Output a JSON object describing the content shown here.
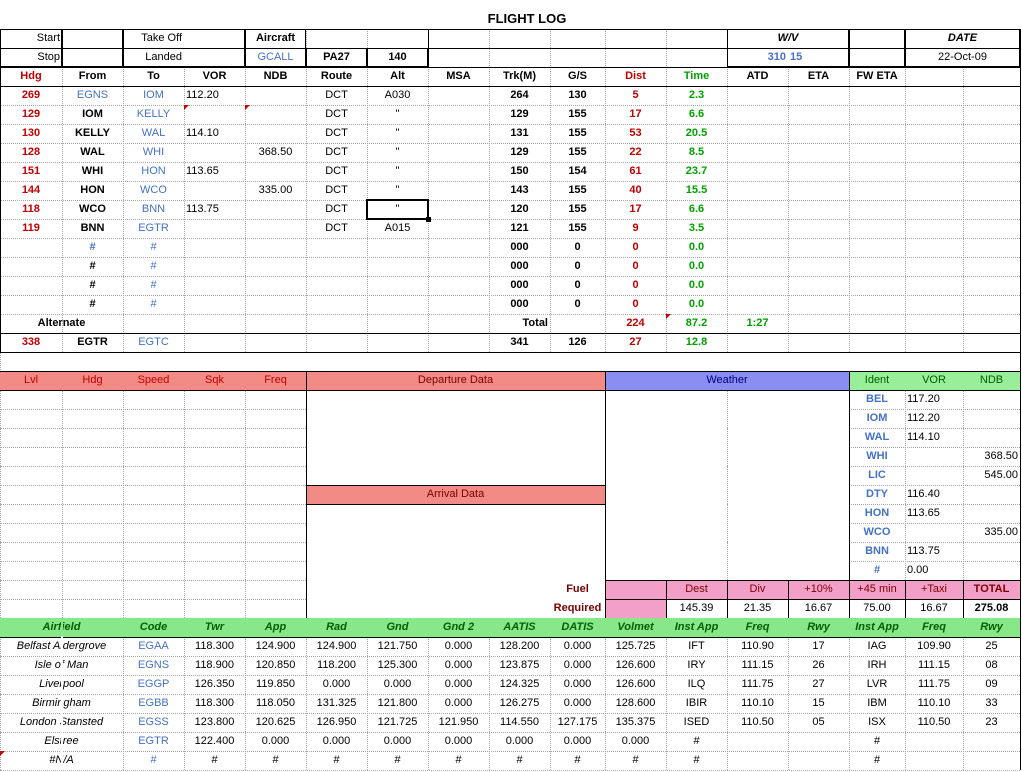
{
  "title": "FLIGHT LOG",
  "header": {
    "start": "Start",
    "stop": "Stop",
    "take_off": "Take Off",
    "landed": "Landed",
    "aircraft_label": "Aircraft",
    "aircraft_reg": "GCALL",
    "aircraft_type": "PA27",
    "aircraft_speed": "140",
    "wv_label": "W/V",
    "wv_dir": "310",
    "wv_speed": "15",
    "date_label": "DATE",
    "date_value": "22-Oct-09"
  },
  "nav": {
    "headers": [
      "Hdg",
      "From",
      "To",
      "VOR",
      "NDB",
      "Route",
      "Alt",
      "MSA",
      "Trk(M)",
      "G/S",
      "Dist",
      "Time",
      "ATD",
      "ETA",
      "FW ETA"
    ],
    "rows": [
      [
        "269",
        "EGNS",
        "IOM",
        "112.20",
        "",
        "DCT",
        "A030",
        "",
        "264",
        "130",
        "5",
        "2.3"
      ],
      [
        "129",
        "IOM",
        "KELLY",
        "",
        "",
        "DCT",
        "\"",
        "",
        "129",
        "155",
        "17",
        "6.6"
      ],
      [
        "130",
        "KELLY",
        "WAL",
        "114.10",
        "",
        "DCT",
        "\"",
        "",
        "131",
        "155",
        "53",
        "20.5"
      ],
      [
        "128",
        "WAL",
        "WHI",
        "",
        "368.50",
        "DCT",
        "\"",
        "",
        "129",
        "155",
        "22",
        "8.5"
      ],
      [
        "151",
        "WHI",
        "HON",
        "113.65",
        "",
        "DCT",
        "\"",
        "",
        "150",
        "154",
        "61",
        "23.7"
      ],
      [
        "144",
        "HON",
        "WCO",
        "",
        "335.00",
        "DCT",
        "\"",
        "",
        "143",
        "155",
        "40",
        "15.5"
      ],
      [
        "118",
        "WCO",
        "BNN",
        "113.75",
        "",
        "DCT",
        "\"",
        "",
        "120",
        "155",
        "17",
        "6.6"
      ],
      [
        "119",
        "BNN",
        "EGTR",
        "",
        "",
        "DCT",
        "A015",
        "",
        "121",
        "155",
        "9",
        "3.5"
      ],
      [
        "",
        "#",
        "#",
        "",
        "",
        "",
        "",
        "",
        "000",
        "0",
        "0",
        "0.0"
      ],
      [
        "",
        "#",
        "#",
        "",
        "",
        "",
        "",
        "",
        "000",
        "0",
        "0",
        "0.0"
      ],
      [
        "",
        "#",
        "#",
        "",
        "",
        "",
        "",
        "",
        "000",
        "0",
        "0",
        "0.0"
      ],
      [
        "",
        "#",
        "#",
        "",
        "",
        "",
        "",
        "",
        "000",
        "0",
        "0",
        "0.0"
      ]
    ],
    "alternate_label": "Alternate",
    "total_label": "Total",
    "total_dist": "224",
    "total_time": "87.2",
    "total_hm": "1:27",
    "alternate": [
      "338",
      "EGTR",
      "EGTC",
      "",
      "",
      "",
      "",
      "",
      "341",
      "126",
      "27",
      "12.8"
    ]
  },
  "mid": {
    "headers": [
      "Lvl",
      "Hdg",
      "Speed",
      "Sqk",
      "Freq"
    ],
    "departure_label": "Departure Data",
    "arrival_label": "Arrival Data",
    "weather_label": "Weather",
    "nav_headers": [
      "Ident",
      "VOR",
      "NDB"
    ],
    "navaids": [
      [
        "BEL",
        "117.20",
        ""
      ],
      [
        "IOM",
        "112.20",
        ""
      ],
      [
        "WAL",
        "114.10",
        ""
      ],
      [
        "WHI",
        "",
        "368.50"
      ],
      [
        "LIC",
        "",
        "545.00"
      ],
      [
        "DTY",
        "116.40",
        ""
      ],
      [
        "HON",
        "113.65",
        ""
      ],
      [
        "WCO",
        "",
        "335.00"
      ],
      [
        "BNN",
        "113.75",
        ""
      ],
      [
        "#",
        "0.00",
        ""
      ]
    ]
  },
  "fuel": {
    "label_1": "Fuel",
    "label_2": "Required",
    "headers": [
      "Dest",
      "Div",
      "+10%",
      "+45 min",
      "+Taxi",
      "TOTAL"
    ],
    "values": [
      "145.39",
      "21.35",
      "16.67",
      "75.00",
      "16.67",
      "275.08"
    ]
  },
  "airfields": {
    "headers": [
      "Airfield",
      "Code",
      "Twr",
      "App",
      "Rad",
      "Gnd",
      "Gnd 2",
      "AATIS",
      "DATIS",
      "Volmet",
      "Inst App",
      "Freq",
      "Rwy",
      "Inst App",
      "Freq",
      "Rwy"
    ],
    "rows": [
      [
        "Belfast Aldergrove",
        "EGAA",
        "118.300",
        "124.900",
        "124.900",
        "121.750",
        "0.000",
        "128.200",
        "0.000",
        "125.725",
        "IFT",
        "110.90",
        "17",
        "IAG",
        "109.90",
        "25"
      ],
      [
        "Isle of Man",
        "EGNS",
        "118.900",
        "120.850",
        "118.200",
        "125.300",
        "0.000",
        "123.875",
        "0.000",
        "126.600",
        "IRY",
        "111.15",
        "26",
        "IRH",
        "111.15",
        "08"
      ],
      [
        "Liverpool",
        "EGGP",
        "126.350",
        "119.850",
        "0.000",
        "0.000",
        "0.000",
        "124.325",
        "0.000",
        "126.600",
        "ILQ",
        "111.75",
        "27",
        "LVR",
        "111.75",
        "09"
      ],
      [
        "Birmingham",
        "EGBB",
        "118.300",
        "118.050",
        "131.325",
        "121.800",
        "0.000",
        "126.275",
        "0.000",
        "128.600",
        "IBIR",
        "110.10",
        "15",
        "IBM",
        "110.10",
        "33"
      ],
      [
        "London Stansted",
        "EGSS",
        "123.800",
        "120.625",
        "126.950",
        "121.725",
        "121.950",
        "114.550",
        "127.175",
        "135.375",
        "ISED",
        "110.50",
        "05",
        "ISX",
        "110.50",
        "23"
      ],
      [
        "Elstree",
        "EGTR",
        "122.400",
        "0.000",
        "0.000",
        "0.000",
        "0.000",
        "0.000",
        "0.000",
        "0.000",
        "#",
        "",
        "",
        "#",
        "",
        ""
      ],
      [
        "#N/A",
        "#",
        "#",
        "#",
        "#",
        "#",
        "#",
        "#",
        "#",
        "#",
        "#",
        "",
        "",
        "#",
        "",
        ""
      ]
    ]
  },
  "colors": {
    "dark_red": "#c00000",
    "blue": "#4472c4",
    "green": "#00a000",
    "red_header": "#f28b85",
    "weather_header": "#8a8ef0",
    "nav_header": "#99ee99",
    "fuel_header": "#f3a0c8",
    "airfield_header": "#88e888"
  }
}
